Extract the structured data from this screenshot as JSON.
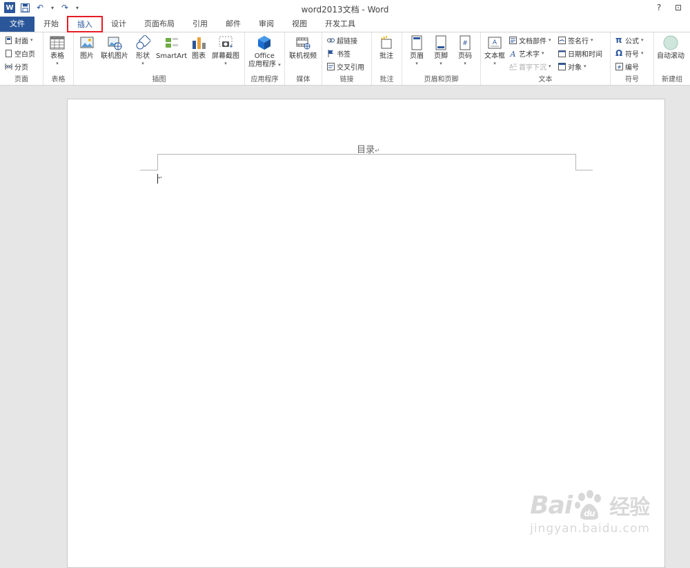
{
  "window": {
    "title": "word2013文档 - Word",
    "help": "?",
    "restore": "⊡",
    "app_logo": "W"
  },
  "qat": {
    "undo": "↶",
    "redo": "↷",
    "customize": "▾"
  },
  "tabs": [
    {
      "label": "文件"
    },
    {
      "label": "开始"
    },
    {
      "label": "插入"
    },
    {
      "label": "设计"
    },
    {
      "label": "页面布局"
    },
    {
      "label": "引用"
    },
    {
      "label": "邮件"
    },
    {
      "label": "审阅"
    },
    {
      "label": "视图"
    },
    {
      "label": "开发工具"
    }
  ],
  "ribbon": {
    "pages": {
      "label": "页面",
      "cover": "封面",
      "blank": "空白页",
      "break": "分页"
    },
    "tables": {
      "label": "表格",
      "table": "表格"
    },
    "illustrations": {
      "label": "插图",
      "picture": "图片",
      "online_picture": "联机图片",
      "shapes": "形状",
      "smartart": "SmartArt",
      "chart": "图表",
      "screenshot": "屏幕截图"
    },
    "apps": {
      "label": "应用程序",
      "office_1": "Office",
      "office_2": "应用程序"
    },
    "media": {
      "label": "媒体",
      "online_video": "联机视频"
    },
    "links": {
      "label": "链接",
      "hyperlink": "超链接",
      "bookmark": "书签",
      "cross_ref": "交叉引用"
    },
    "comments": {
      "label": "批注",
      "comment": "批注"
    },
    "header_footer": {
      "label": "页眉和页脚",
      "header": "页眉",
      "footer": "页脚",
      "page_number": "页码"
    },
    "text": {
      "label": "文本",
      "textbox": "文本框",
      "quick_parts": "文档部件",
      "wordart": "艺术字",
      "drop_cap": "首字下沉",
      "signature": "签名行",
      "datetime": "日期和时间",
      "object": "对象"
    },
    "symbols": {
      "label": "符号",
      "equation": "公式",
      "symbol": "符号",
      "number": "编号"
    },
    "new_group": {
      "label": "新建组",
      "auto_scroll": "自动滚动"
    }
  },
  "document": {
    "toc_title": "目录",
    "para_mark": "↵"
  },
  "watermark": {
    "brand": "Bai",
    "brand2": "du",
    "cn": "经验",
    "url": "jingyan.baidu.com"
  },
  "colors": {
    "accent": "#2b579a",
    "highlight": "#e51b24"
  }
}
